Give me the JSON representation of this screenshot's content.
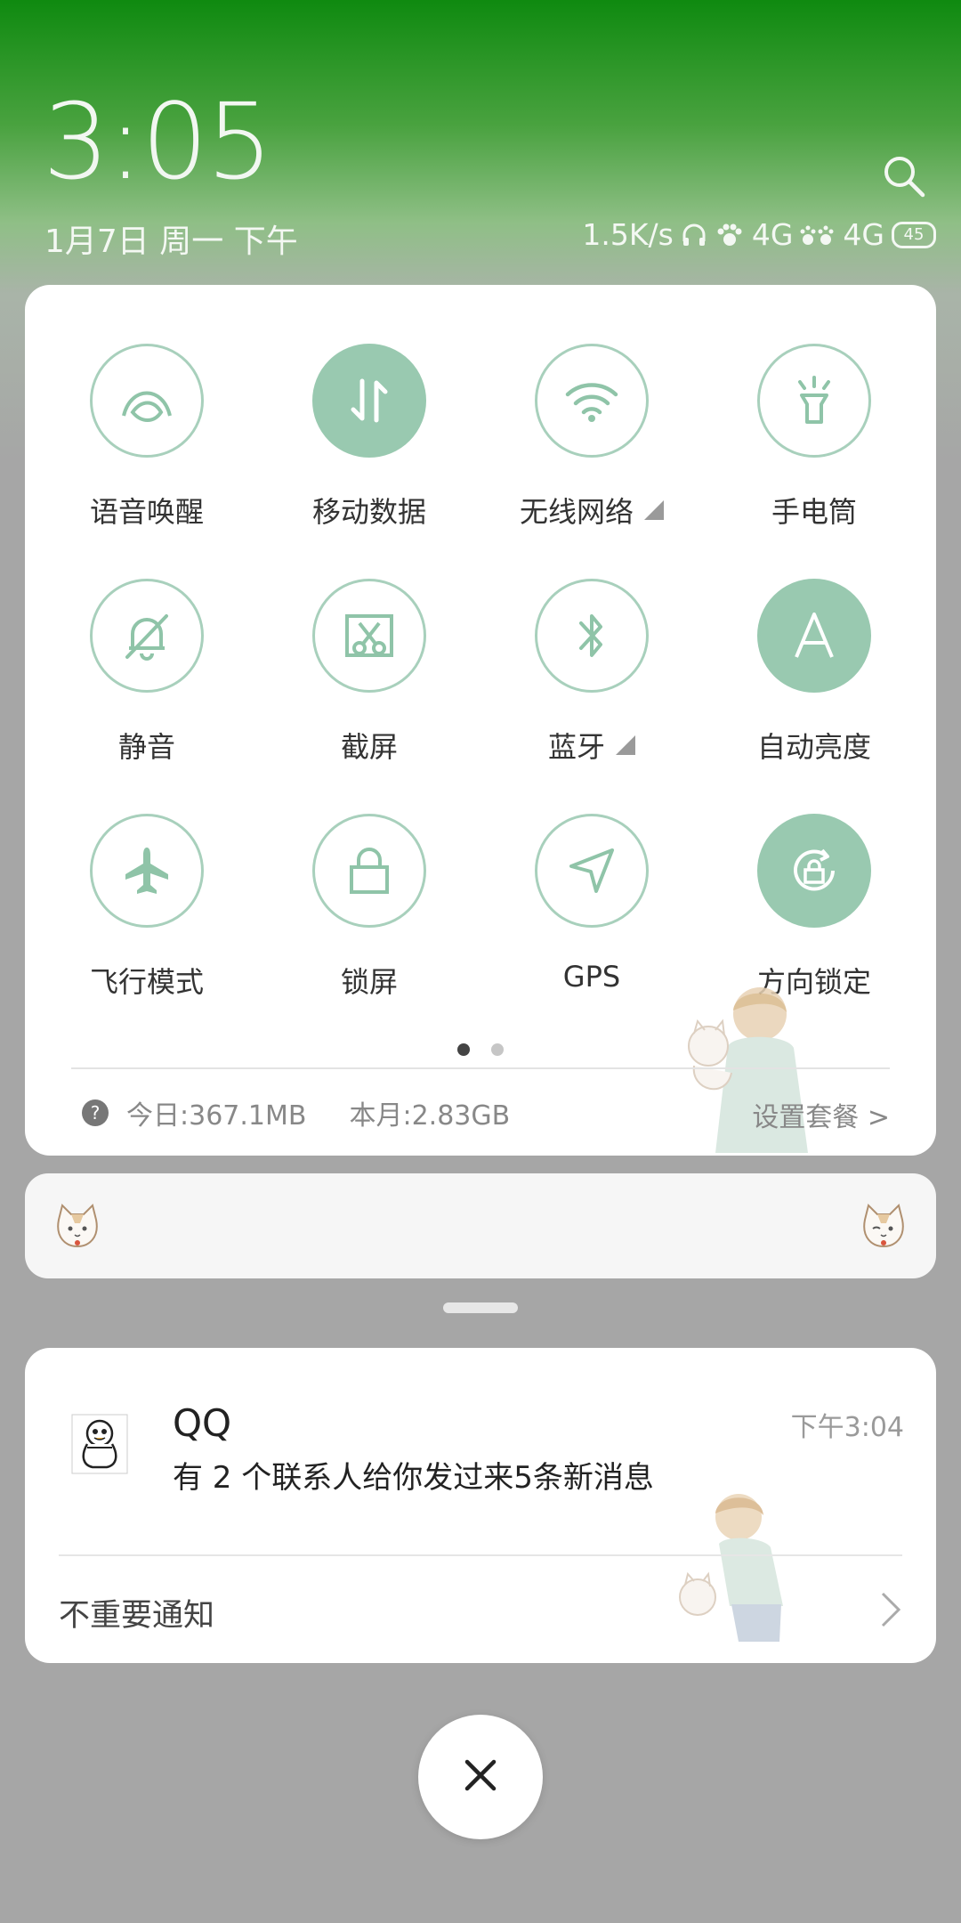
{
  "header": {
    "time": "3:05",
    "date": "1月7日 周一 下午",
    "net_speed": "1.5K/s",
    "sim1_label": "4G",
    "sim2_label": "4G",
    "battery": "45"
  },
  "quick_settings": {
    "tiles": [
      {
        "label": "语音唤醒",
        "icon": "voice-wake-icon",
        "active": false
      },
      {
        "label": "移动数据",
        "icon": "mobile-data-icon",
        "active": true
      },
      {
        "label": "无线网络",
        "icon": "wifi-icon",
        "active": false,
        "has_more": true
      },
      {
        "label": "手电筒",
        "icon": "flashlight-icon",
        "active": false
      },
      {
        "label": "静音",
        "icon": "mute-bell-icon",
        "active": false
      },
      {
        "label": "截屏",
        "icon": "screenshot-icon",
        "active": false
      },
      {
        "label": "蓝牙",
        "icon": "bluetooth-icon",
        "active": false,
        "has_more": true
      },
      {
        "label": "自动亮度",
        "icon": "auto-brightness-icon",
        "active": true
      },
      {
        "label": "飞行模式",
        "icon": "airplane-icon",
        "active": false
      },
      {
        "label": "锁屏",
        "icon": "lock-icon",
        "active": false
      },
      {
        "label": "GPS",
        "icon": "gps-icon",
        "active": false
      },
      {
        "label": "方向锁定",
        "icon": "rotation-lock-icon",
        "active": true
      }
    ],
    "page_count": 2,
    "current_page": 1,
    "data_today": "今日:367.1MB",
    "data_month": "本月:2.83GB",
    "plan_link": "设置套餐 >",
    "help_glyph": "?"
  },
  "notification": {
    "app_name": "QQ",
    "time": "下午3:04",
    "text": "有 2 个联系人给你发过来5条新消息",
    "footer": "不重要通知"
  },
  "colors": {
    "accent": "#99c9b0",
    "accent_border": "#a8d0bc",
    "icon_green": "#8fc4a8"
  }
}
